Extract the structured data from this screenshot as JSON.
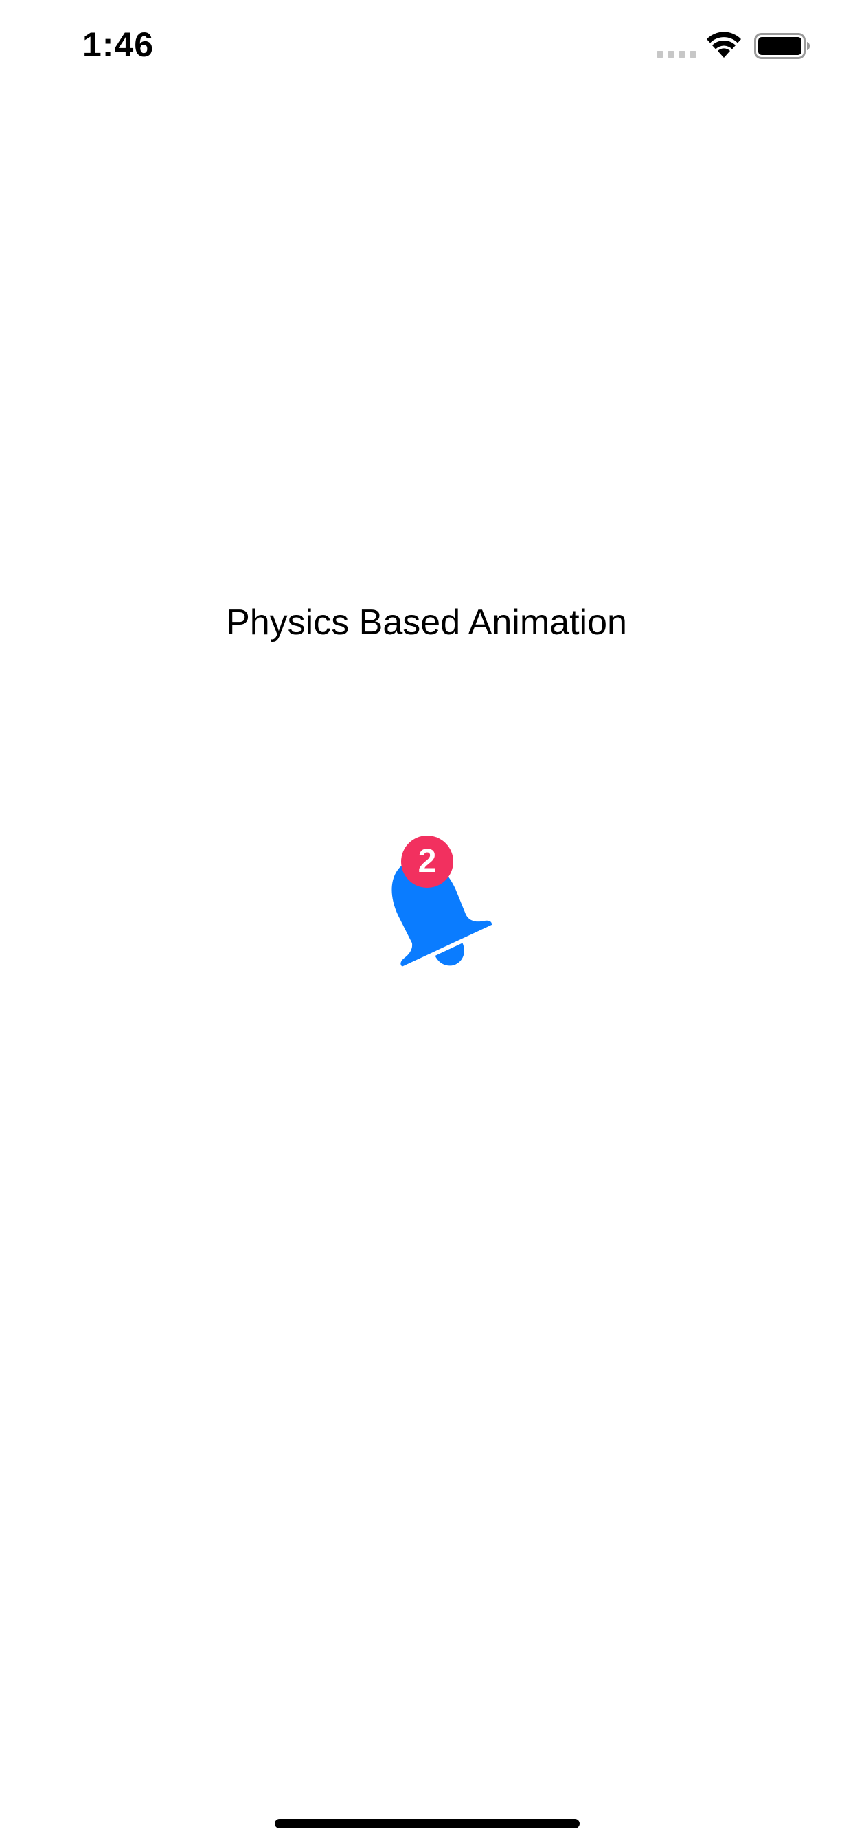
{
  "status_bar": {
    "time": "1:46",
    "signal_icon": "cellular-signal-icon",
    "wifi_icon": "wifi-icon",
    "battery_icon": "battery-full-icon"
  },
  "main": {
    "title": "Physics Based Animation",
    "bell": {
      "icon": "bell-icon",
      "color": "#0a7cff",
      "badge_count": "2",
      "badge_color": "#f2305f"
    }
  }
}
